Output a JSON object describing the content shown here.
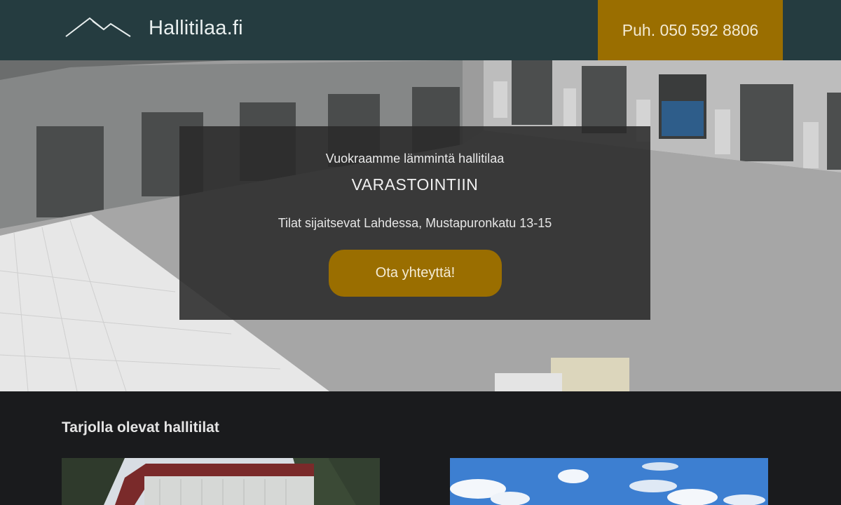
{
  "header": {
    "brand": "Hallitilaa.fi",
    "phone": "Puh. 050 592 8806",
    "logo_icon": "mountains-icon"
  },
  "hero": {
    "subtitle": "Vuokraamme lämmintä hallitilaa",
    "title": "VARASTOINTIIN",
    "location": "Tilat sijaitsevat Lahdessa, Mustapuronkatu 13-15",
    "cta_label": "Ota yhteyttä!"
  },
  "listings": {
    "title": "Tarjolla olevat hallitilat"
  },
  "colors": {
    "header_bg": "#253c40",
    "accent": "#9a6e00",
    "dark_bg": "#1a1b1d"
  }
}
